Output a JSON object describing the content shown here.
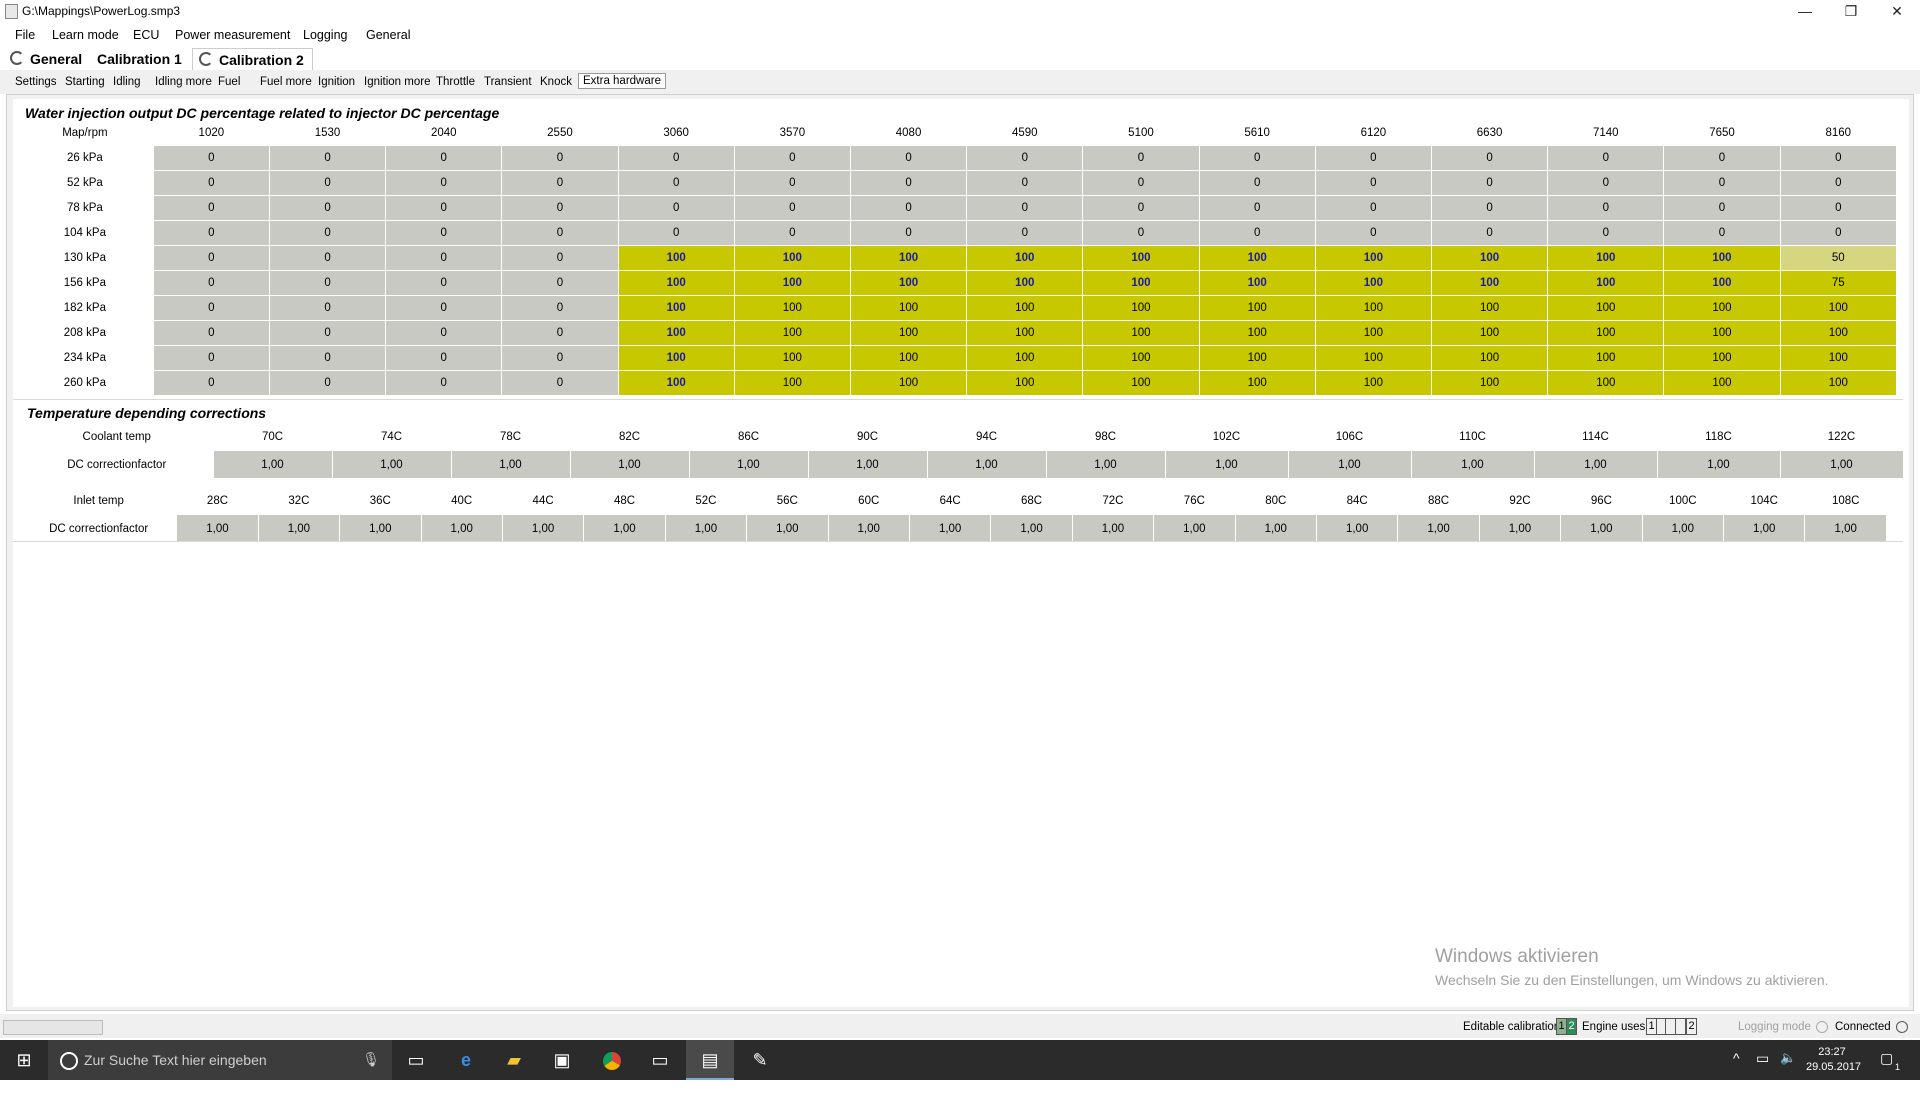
{
  "window": {
    "title": "G:\\Mappings\\PowerLog.smp3",
    "minimize": "—",
    "restore": "❐",
    "close": "✕"
  },
  "menu": [
    "File",
    "Learn mode",
    "ECU",
    "Power measurement",
    "Logging",
    "General"
  ],
  "cal_tabs": {
    "general": "General",
    "cal1": "Calibration 1",
    "cal2": "Calibration 2"
  },
  "sub_tabs": [
    "Settings",
    "Starting",
    "Idling",
    "Idling more",
    "Fuel",
    "Fuel more",
    "Ignition",
    "Ignition more",
    "Throttle",
    "Transient",
    "Knock",
    "Extra hardware"
  ],
  "water": {
    "title": "Water injection output DC percentage related to injector DC percentage",
    "corner": "Map/rpm",
    "rpm": [
      "1020",
      "1530",
      "2040",
      "2550",
      "3060",
      "3570",
      "4080",
      "4590",
      "5100",
      "5610",
      "6120",
      "6630",
      "7140",
      "7650",
      "8160"
    ],
    "map": [
      "26 kPa",
      "52 kPa",
      "78 kPa",
      "104 kPa",
      "130 kPa",
      "156 kPa",
      "182 kPa",
      "208 kPa",
      "234 kPa",
      "260 kPa"
    ],
    "values": [
      [
        0,
        0,
        0,
        0,
        0,
        0,
        0,
        0,
        0,
        0,
        0,
        0,
        0,
        0,
        0
      ],
      [
        0,
        0,
        0,
        0,
        0,
        0,
        0,
        0,
        0,
        0,
        0,
        0,
        0,
        0,
        0
      ],
      [
        0,
        0,
        0,
        0,
        0,
        0,
        0,
        0,
        0,
        0,
        0,
        0,
        0,
        0,
        0
      ],
      [
        0,
        0,
        0,
        0,
        0,
        0,
        0,
        0,
        0,
        0,
        0,
        0,
        0,
        0,
        0
      ],
      [
        0,
        0,
        0,
        0,
        100,
        100,
        100,
        100,
        100,
        100,
        100,
        100,
        100,
        100,
        50
      ],
      [
        0,
        0,
        0,
        0,
        100,
        100,
        100,
        100,
        100,
        100,
        100,
        100,
        100,
        100,
        75
      ],
      [
        0,
        0,
        0,
        0,
        100,
        100,
        100,
        100,
        100,
        100,
        100,
        100,
        100,
        100,
        100
      ],
      [
        0,
        0,
        0,
        0,
        100,
        100,
        100,
        100,
        100,
        100,
        100,
        100,
        100,
        100,
        100
      ],
      [
        0,
        0,
        0,
        0,
        100,
        100,
        100,
        100,
        100,
        100,
        100,
        100,
        100,
        100,
        100
      ],
      [
        0,
        0,
        0,
        0,
        100,
        100,
        100,
        100,
        100,
        100,
        100,
        100,
        100,
        100,
        100
      ]
    ]
  },
  "temp": {
    "title": "Temperature depending corrections",
    "coolant_label": "Coolant temp",
    "coolant": [
      "70C",
      "74C",
      "78C",
      "82C",
      "86C",
      "90C",
      "94C",
      "98C",
      "102C",
      "106C",
      "110C",
      "114C",
      "118C",
      "122C"
    ],
    "dc_label": "DC correctionfactor",
    "coolant_dc": [
      "1,00",
      "1,00",
      "1,00",
      "1,00",
      "1,00",
      "1,00",
      "1,00",
      "1,00",
      "1,00",
      "1,00",
      "1,00",
      "1,00",
      "1,00",
      "1,00"
    ],
    "inlet_label": "Inlet temp",
    "inlet": [
      "28C",
      "32C",
      "36C",
      "40C",
      "44C",
      "48C",
      "52C",
      "56C",
      "60C",
      "64C",
      "68C",
      "72C",
      "76C",
      "80C",
      "84C",
      "88C",
      "92C",
      "96C",
      "100C",
      "104C",
      "108C"
    ],
    "inlet_dc": [
      "1,00",
      "1,00",
      "1,00",
      "1,00",
      "1,00",
      "1,00",
      "1,00",
      "1,00",
      "1,00",
      "1,00",
      "1,00",
      "1,00",
      "1,00",
      "1,00",
      "1,00",
      "1,00",
      "1,00",
      "1,00",
      "1,00",
      "1,00",
      "1,00"
    ]
  },
  "watermark": {
    "line1": "Windows aktivieren",
    "line2": "Wechseln Sie zu den Einstellungen, um Windows zu aktivieren."
  },
  "status": {
    "editable_label": "Editable calibration",
    "editable_1": "1",
    "editable_2": "2",
    "engine_label": "Engine uses",
    "engine_1": "1",
    "engine_2": "2",
    "logging_mode": "Logging mode",
    "connected": "Connected"
  },
  "taskbar": {
    "search_placeholder": "Zur Suche Text hier eingeben",
    "time": "23:27",
    "date": "29.05.2017",
    "notif_count": "1"
  }
}
